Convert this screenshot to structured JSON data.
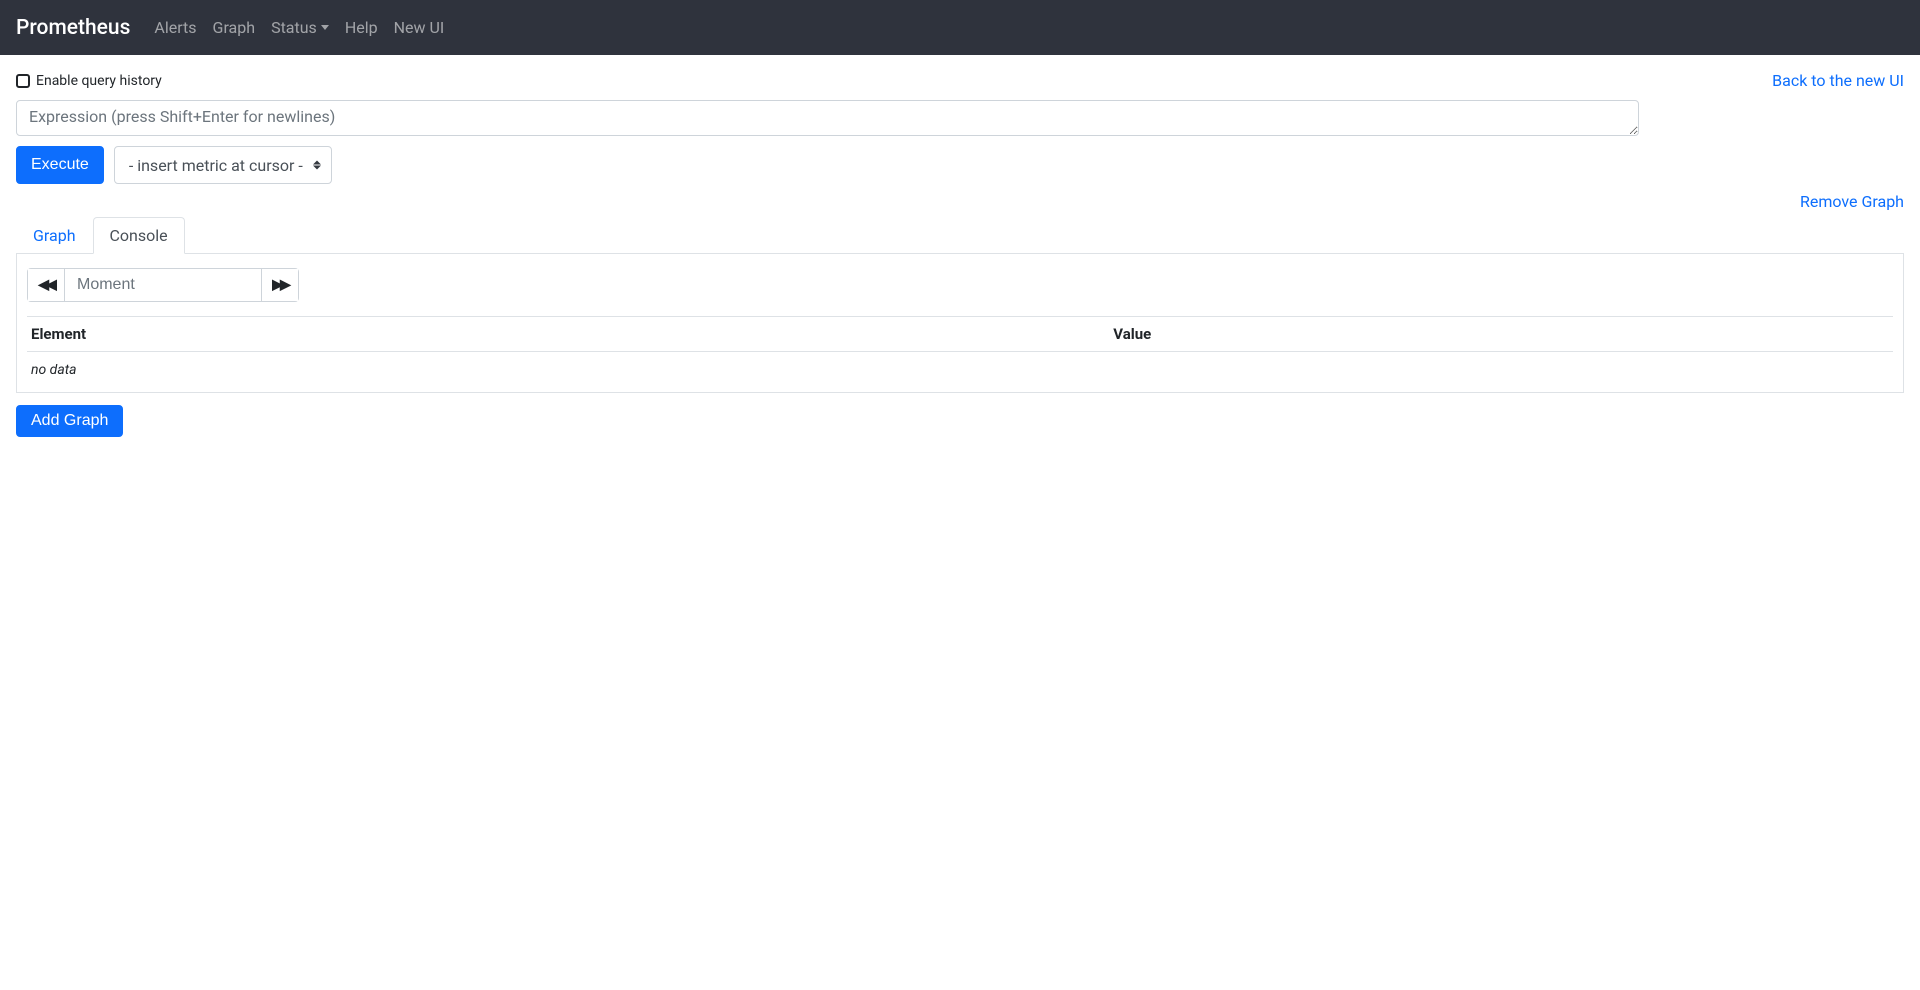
{
  "navbar": {
    "brand": "Prometheus",
    "items": {
      "alerts": "Alerts",
      "graph": "Graph",
      "status": "Status",
      "help": "Help",
      "new_ui": "New UI"
    }
  },
  "top": {
    "enable_history": "Enable query history",
    "back_link": "Back to the new UI"
  },
  "query": {
    "expression_placeholder": "Expression (press Shift+Enter for newlines)",
    "execute_label": "Execute",
    "metric_select": "- insert metric at cursor -"
  },
  "graph_panel": {
    "remove_link": "Remove Graph",
    "tabs": {
      "graph": "Graph",
      "console": "Console"
    },
    "moment_placeholder": "Moment",
    "table": {
      "col_element": "Element",
      "col_value": "Value",
      "no_data": "no data"
    }
  },
  "footer": {
    "add_graph": "Add Graph"
  }
}
